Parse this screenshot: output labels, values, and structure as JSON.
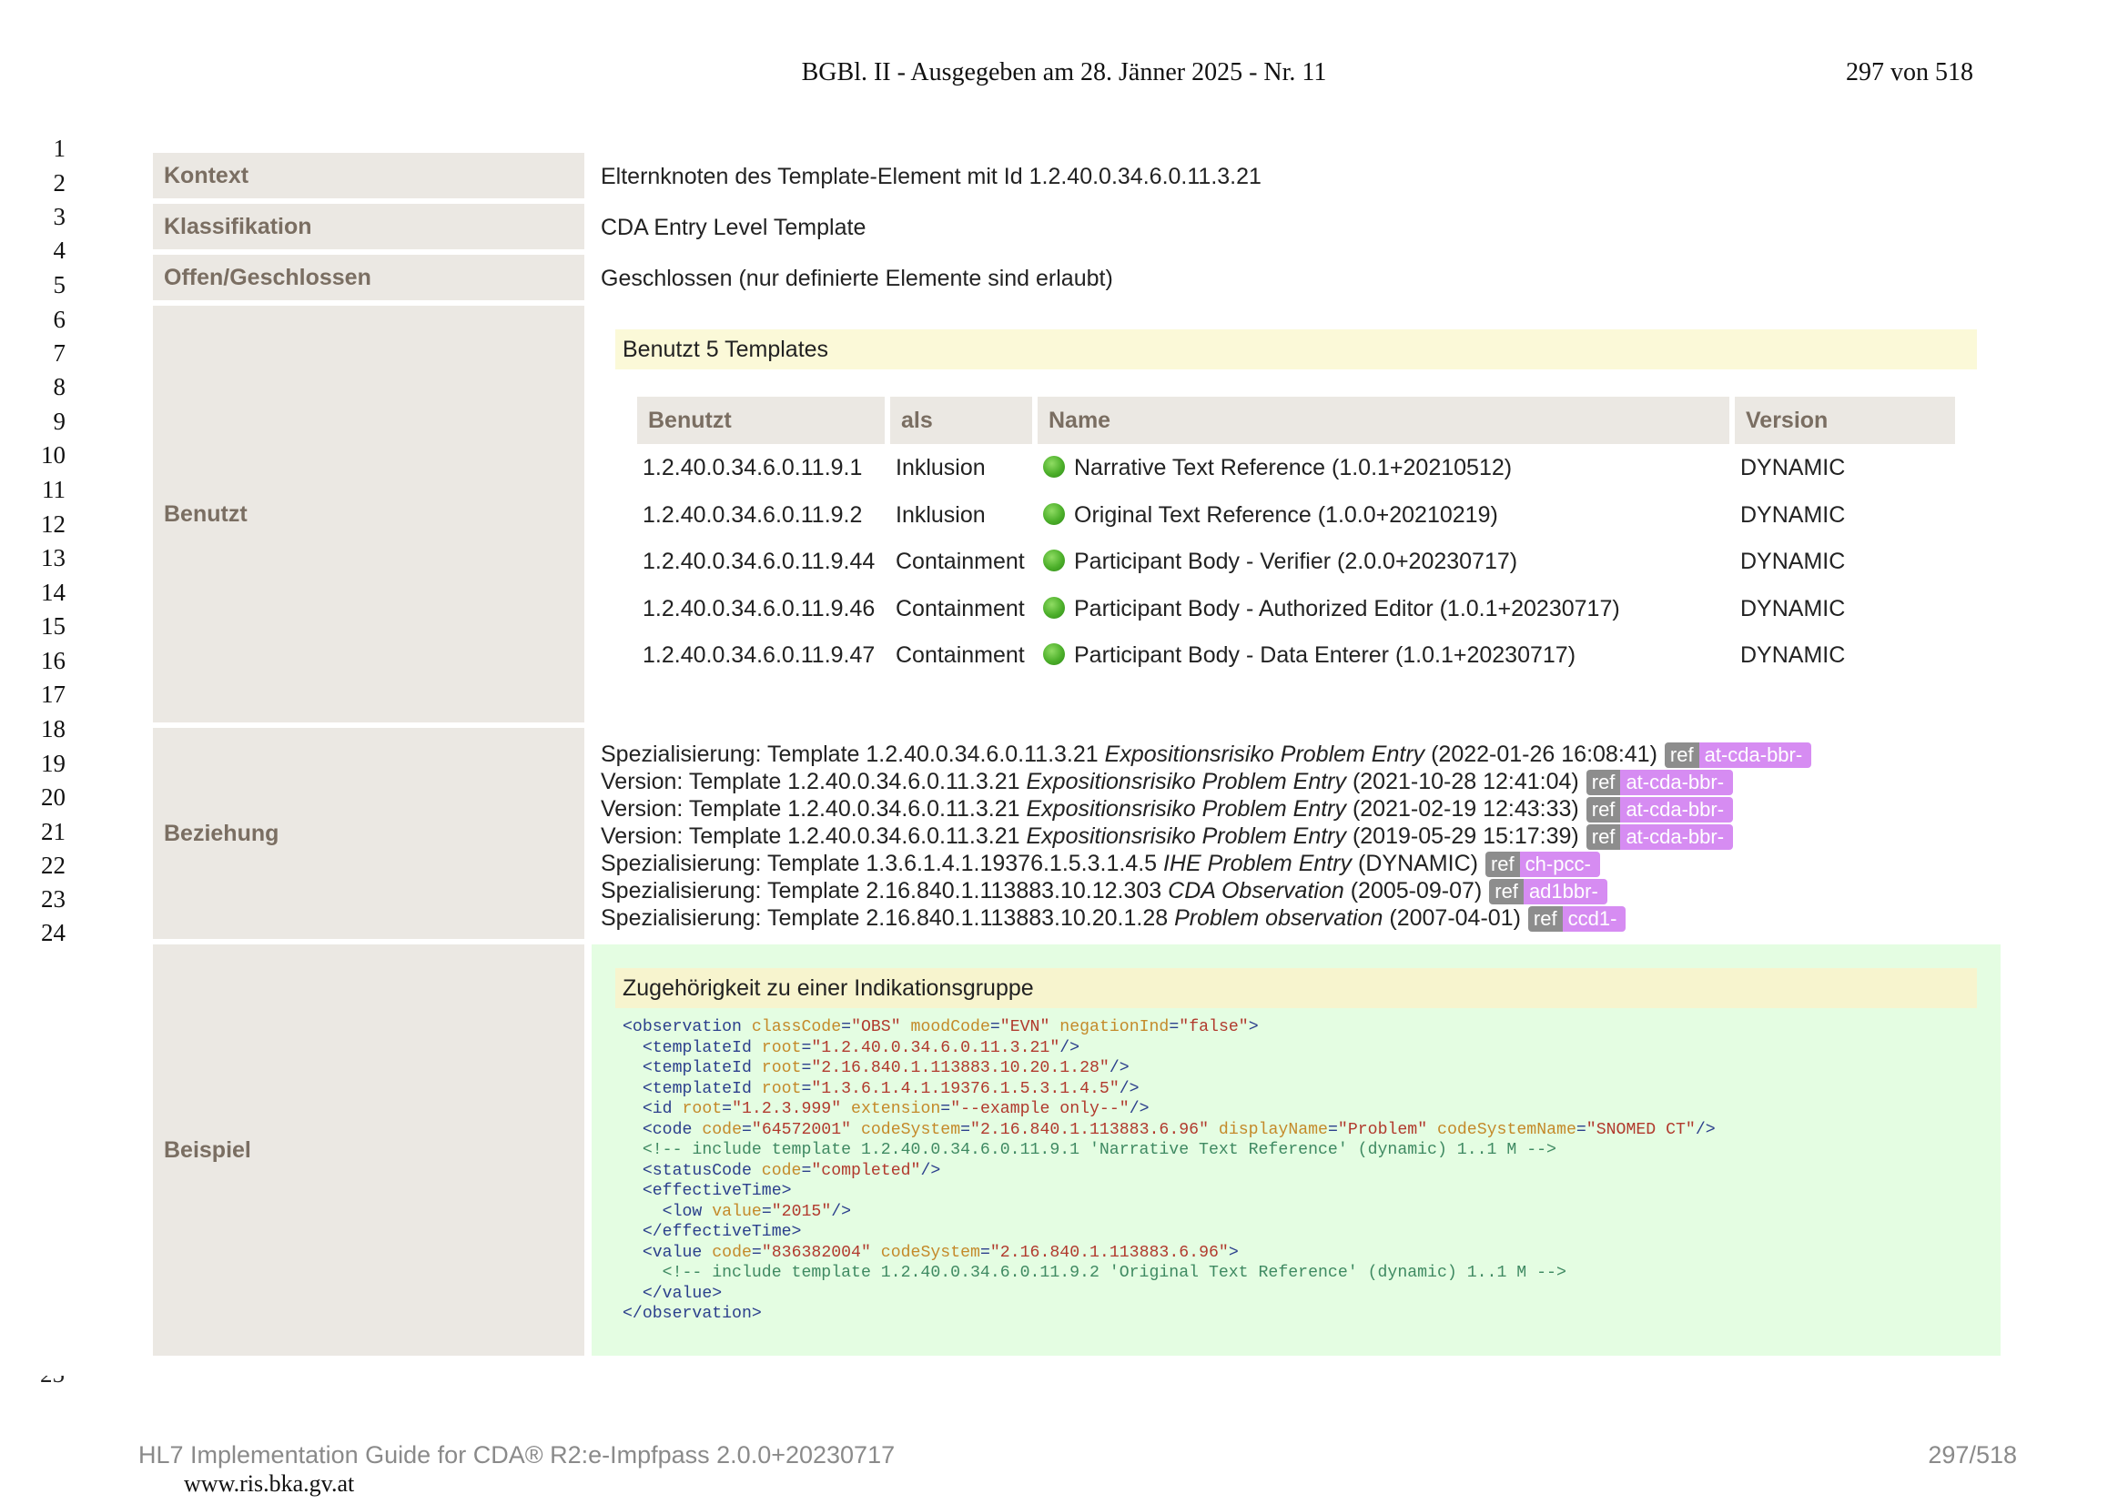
{
  "header": {
    "title": "BGBl. II - Ausgegeben am 28. Jänner 2025 - Nr. 11",
    "page": "297 von 518"
  },
  "line_numbers": [
    "1",
    "2",
    "3",
    "4",
    "5",
    "6",
    "7",
    "8",
    "9",
    "10",
    "11",
    "12",
    "13",
    "14",
    "15",
    "16",
    "17",
    "18",
    "19",
    "20",
    "21",
    "22",
    "23",
    "24"
  ],
  "line_number_cut": "25",
  "rows": {
    "kontext": {
      "label": "Kontext",
      "value": "Elternknoten des Template-Element mit Id 1.2.40.0.34.6.0.11.3.21"
    },
    "klassifikation": {
      "label": "Klassifikation",
      "value": "CDA Entry Level Template"
    },
    "offen": {
      "label": "Offen/Geschlossen",
      "value": "Geschlossen (nur definierte Elemente sind erlaubt)"
    },
    "benutzt": {
      "label": "Benutzt"
    },
    "beziehung": {
      "label": "Beziehung"
    },
    "beispiel": {
      "label": "Beispiel"
    }
  },
  "benutzt": {
    "heading": "Benutzt 5 Templates",
    "columns": [
      "Benutzt",
      "als",
      "Name",
      "Version"
    ],
    "rows": [
      {
        "id": "1.2.40.0.34.6.0.11.9.1",
        "als": "Inklusion",
        "name": "Narrative Text Reference (1.0.1+20210512)",
        "version": "DYNAMIC"
      },
      {
        "id": "1.2.40.0.34.6.0.11.9.2",
        "als": "Inklusion",
        "name": "Original Text Reference (1.0.0+20210219)",
        "version": "DYNAMIC"
      },
      {
        "id": "1.2.40.0.34.6.0.11.9.44",
        "als": "Containment",
        "name": "Participant Body - Verifier (2.0.0+20230717)",
        "version": "DYNAMIC"
      },
      {
        "id": "1.2.40.0.34.6.0.11.9.46",
        "als": "Containment",
        "name": "Participant Body - Authorized Editor (1.0.1+20230717)",
        "version": "DYNAMIC"
      },
      {
        "id": "1.2.40.0.34.6.0.11.9.47",
        "als": "Containment",
        "name": "Participant Body - Data Enterer (1.0.1+20230717)",
        "version": "DYNAMIC"
      }
    ],
    "status_icon": "green-dot-icon"
  },
  "beziehung": [
    {
      "kind": "Spezialisierung: Template 1.2.40.0.34.6.0.11.3.21",
      "name": "Expositionsrisiko Problem Entry",
      "date": "(2022-01-26 16:08:41)",
      "ref": "ref",
      "prefix": "at-cda-bbr-"
    },
    {
      "kind": "Version: Template 1.2.40.0.34.6.0.11.3.21",
      "name": "Expositionsrisiko Problem Entry",
      "date": "(2021-10-28 12:41:04)",
      "ref": "ref",
      "prefix": "at-cda-bbr-"
    },
    {
      "kind": "Version: Template 1.2.40.0.34.6.0.11.3.21",
      "name": "Expositionsrisiko Problem Entry",
      "date": "(2021-02-19 12:43:33)",
      "ref": "ref",
      "prefix": "at-cda-bbr-"
    },
    {
      "kind": "Version: Template 1.2.40.0.34.6.0.11.3.21",
      "name": "Expositionsrisiko Problem Entry",
      "date": "(2019-05-29 15:17:39)",
      "ref": "ref",
      "prefix": "at-cda-bbr-"
    },
    {
      "kind": "Spezialisierung: Template 1.3.6.1.4.1.19376.1.5.3.1.4.5",
      "name": "IHE Problem Entry",
      "date": "(DYNAMIC)",
      "ref": "ref",
      "prefix": "ch-pcc-"
    },
    {
      "kind": "Spezialisierung: Template 2.16.840.1.113883.10.12.303",
      "name": "CDA Observation",
      "date": "(2005-09-07)",
      "ref": "ref",
      "prefix": "ad1bbr-"
    },
    {
      "kind": "Spezialisierung: Template 2.16.840.1.113883.10.20.1.28",
      "name": "Problem observation",
      "date": "(2007-04-01)",
      "ref": "ref",
      "prefix": "ccd1-"
    }
  ],
  "beispiel": {
    "heading": "Zugehörigkeit zu einer Indikationsgruppe",
    "code_lines": [
      [
        [
          "t",
          "<observation"
        ],
        [
          "a",
          " classCode"
        ],
        [
          "p",
          "="
        ],
        [
          "v",
          "\"OBS\""
        ],
        [
          "a",
          " moodCode"
        ],
        [
          "p",
          "="
        ],
        [
          "v",
          "\"EVN\""
        ],
        [
          "a",
          " negationInd"
        ],
        [
          "p",
          "="
        ],
        [
          "v",
          "\"false\""
        ],
        [
          "t",
          ">"
        ]
      ],
      [
        [
          "t",
          "  <templateId"
        ],
        [
          "a",
          " root"
        ],
        [
          "p",
          "="
        ],
        [
          "v",
          "\"1.2.40.0.34.6.0.11.3.21\""
        ],
        [
          "t",
          "/>"
        ]
      ],
      [
        [
          "t",
          "  <templateId"
        ],
        [
          "a",
          " root"
        ],
        [
          "p",
          "="
        ],
        [
          "v",
          "\"2.16.840.1.113883.10.20.1.28\""
        ],
        [
          "t",
          "/>"
        ]
      ],
      [
        [
          "t",
          "  <templateId"
        ],
        [
          "a",
          " root"
        ],
        [
          "p",
          "="
        ],
        [
          "v",
          "\"1.3.6.1.4.1.19376.1.5.3.1.4.5\""
        ],
        [
          "t",
          "/>"
        ]
      ],
      [
        [
          "t",
          "  <id"
        ],
        [
          "a",
          " root"
        ],
        [
          "p",
          "="
        ],
        [
          "v",
          "\"1.2.3.999\""
        ],
        [
          "a",
          " extension"
        ],
        [
          "p",
          "="
        ],
        [
          "v",
          "\"--example only--\""
        ],
        [
          "t",
          "/>"
        ]
      ],
      [
        [
          "t",
          "  <code"
        ],
        [
          "a",
          " code"
        ],
        [
          "p",
          "="
        ],
        [
          "v",
          "\"64572001\""
        ],
        [
          "a",
          " codeSystem"
        ],
        [
          "p",
          "="
        ],
        [
          "v",
          "\"2.16.840.1.113883.6.96\""
        ],
        [
          "a",
          " displayName"
        ],
        [
          "p",
          "="
        ],
        [
          "v",
          "\"Problem\""
        ],
        [
          "a",
          " codeSystemName"
        ],
        [
          "p",
          "="
        ],
        [
          "v",
          "\"SNOMED CT\""
        ],
        [
          "t",
          "/>"
        ]
      ],
      [
        [
          "c",
          "  <!-- include template 1.2.40.0.34.6.0.11.9.1 'Narrative Text Reference' (dynamic) 1..1 M -->"
        ]
      ],
      [
        [
          "t",
          "  <statusCode"
        ],
        [
          "a",
          " code"
        ],
        [
          "p",
          "="
        ],
        [
          "v",
          "\"completed\""
        ],
        [
          "t",
          "/>"
        ]
      ],
      [
        [
          "t",
          "  <effectiveTime>"
        ]
      ],
      [
        [
          "t",
          "    <low"
        ],
        [
          "a",
          " value"
        ],
        [
          "p",
          "="
        ],
        [
          "v",
          "\"2015\""
        ],
        [
          "t",
          "/>"
        ]
      ],
      [
        [
          "t",
          "  </effectiveTime>"
        ]
      ],
      [
        [
          "t",
          "  <value"
        ],
        [
          "a",
          " code"
        ],
        [
          "p",
          "="
        ],
        [
          "v",
          "\"836382004\""
        ],
        [
          "a",
          " codeSystem"
        ],
        [
          "p",
          "="
        ],
        [
          "v",
          "\"2.16.840.1.113883.6.96\""
        ],
        [
          "t",
          ">"
        ]
      ],
      [
        [
          "c",
          "    <!-- include template 1.2.40.0.34.6.0.11.9.2 'Original Text Reference' (dynamic) 1..1 M -->"
        ]
      ],
      [
        [
          "t",
          "  </value>"
        ]
      ],
      [
        [
          "t",
          "</observation>"
        ]
      ]
    ]
  },
  "footer": {
    "left": "HL7 Implementation Guide for CDA® R2:e-Impfpass 2.0.0+20230717",
    "right": "297/518",
    "url": "www.ris.bka.gv.at"
  }
}
